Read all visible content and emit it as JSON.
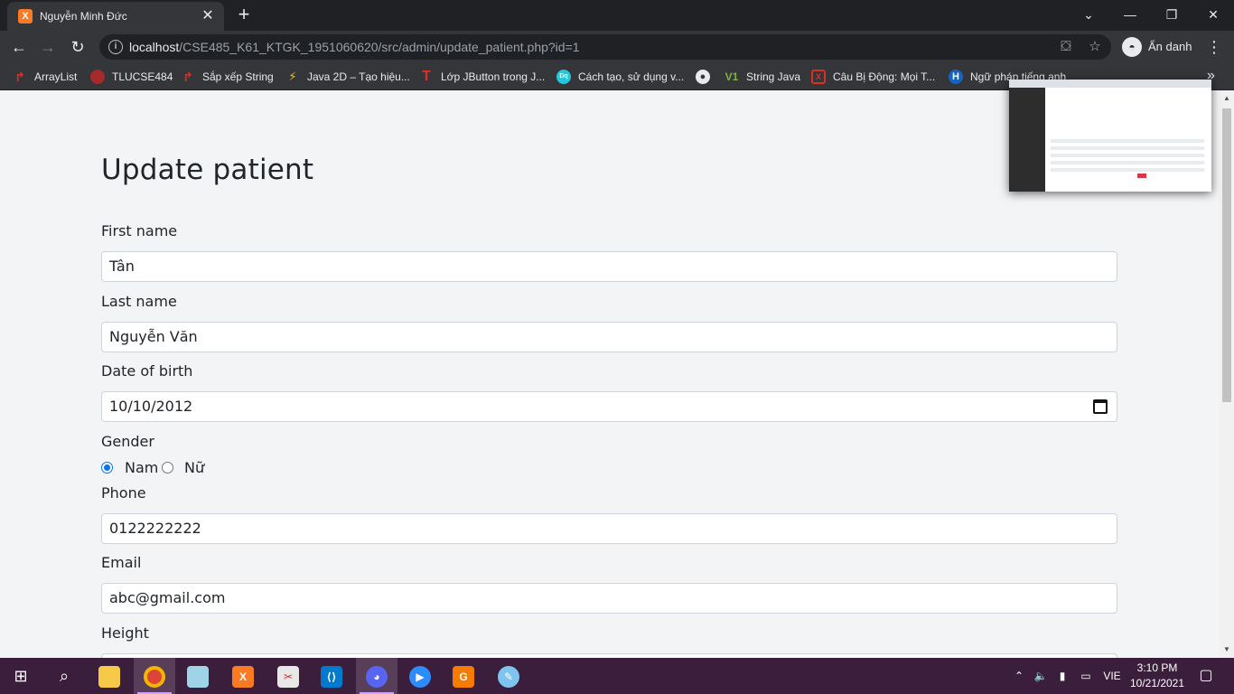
{
  "browser": {
    "tab_title": "Nguyễn Minh Đức",
    "tab_favicon": "X",
    "url_host": "localhost",
    "url_path": "/CSE485_K61_KTGK_1951060620/src/admin/update_patient.php?id=1",
    "incognito_label": "Ẩn danh",
    "bookmarks": [
      {
        "label": "ArrayList",
        "icon": "↱",
        "color": "#d93025"
      },
      {
        "label": "TLUCSE484",
        "icon": "◆",
        "color": "#a52a2a"
      },
      {
        "label": "Sắp xếp String",
        "icon": "↱",
        "color": "#d93025"
      },
      {
        "label": "Java 2D – Tạo hiệu...",
        "icon": "⚡",
        "color": "#f4c20d"
      },
      {
        "label": "Lớp JButton trong J...",
        "icon": "T",
        "color": "#d93025"
      },
      {
        "label": "Cách tạo, sử dụng v...",
        "icon": "Dq",
        "color": "#26c6da"
      },
      {
        "label": "",
        "icon": "◉",
        "color": "#e8eaed"
      },
      {
        "label": "String Java",
        "icon": "V1",
        "color": "#7cb342"
      },
      {
        "label": "Câu Bị Động: Mọi T...",
        "icon": "⊠",
        "color": "#d93025"
      },
      {
        "label": "Ngữ pháp tiếng anh",
        "icon": "H",
        "color": "#1565c0"
      }
    ]
  },
  "form": {
    "title": "Update patient",
    "first_name_label": "First name",
    "first_name_value": "Tân",
    "last_name_label": "Last name",
    "last_name_value": "Nguyễn Văn",
    "dob_label": "Date of birth",
    "dob_value": "10/10/2012",
    "gender_label": "Gender",
    "gender_options": [
      "Nam",
      "Nữ"
    ],
    "gender_selected": "Nam",
    "phone_label": "Phone",
    "phone_value": "0122222222",
    "email_label": "Email",
    "email_value": "abc@gmail.com",
    "height_label": "Height"
  },
  "taskbar": {
    "language": "VIE",
    "time": "3:10 PM",
    "date": "10/21/2021"
  }
}
